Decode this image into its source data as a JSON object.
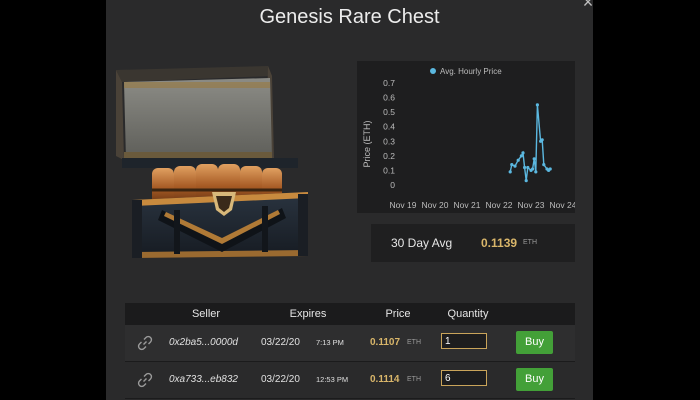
{
  "modal": {
    "title": "Genesis Rare Chest",
    "close_glyph": "×"
  },
  "chart_data": {
    "type": "line",
    "legend": "Avg. Hourly Price",
    "ylabel": "Price  (ETH)",
    "xlabel": "",
    "ylim": [
      0,
      0.7
    ],
    "yticks": [
      "0",
      "0.1",
      "0.2",
      "0.3",
      "0.4",
      "0.5",
      "0.6",
      "0.7"
    ],
    "xticks": [
      "Nov 19",
      "Nov 20",
      "Nov 21",
      "Nov 22",
      "Nov 23",
      "Nov 24"
    ],
    "xlim": [
      19,
      24
    ],
    "color": "#5bb8e0",
    "points": [
      [
        22.35,
        0.09
      ],
      [
        22.4,
        0.14
      ],
      [
        22.5,
        0.13
      ],
      [
        22.6,
        0.17
      ],
      [
        22.7,
        0.2
      ],
      [
        22.75,
        0.22
      ],
      [
        22.8,
        0.12
      ],
      [
        22.85,
        0.03
      ],
      [
        22.9,
        0.12
      ],
      [
        23.0,
        0.1
      ],
      [
        23.05,
        0.11
      ],
      [
        23.1,
        0.18
      ],
      [
        23.15,
        0.09
      ],
      [
        23.2,
        0.55
      ],
      [
        23.3,
        0.3
      ],
      [
        23.35,
        0.31
      ],
      [
        23.4,
        0.14
      ],
      [
        23.5,
        0.11
      ],
      [
        23.55,
        0.1
      ],
      [
        23.6,
        0.11
      ]
    ]
  },
  "avg": {
    "label": "30 Day Avg",
    "value": "0.1139",
    "unit": "ETH"
  },
  "table": {
    "headers": [
      "Seller",
      "Expires",
      "Price",
      "Quantity"
    ],
    "rows": [
      {
        "seller": "0x2ba5...0000d",
        "date": "03/22/20",
        "time": "7:13 PM",
        "price": "0.1107",
        "unit": "ETH",
        "quantity": "1",
        "buy": "Buy"
      },
      {
        "seller": "0xa733...eb832",
        "date": "03/22/20",
        "time": "12:53 PM",
        "price": "0.1114",
        "unit": "ETH",
        "quantity": "6",
        "buy": "Buy"
      }
    ]
  },
  "colors": {
    "accent_gold": "#d9b66a",
    "buy_green": "#43a038",
    "line_blue": "#5bb8e0"
  }
}
